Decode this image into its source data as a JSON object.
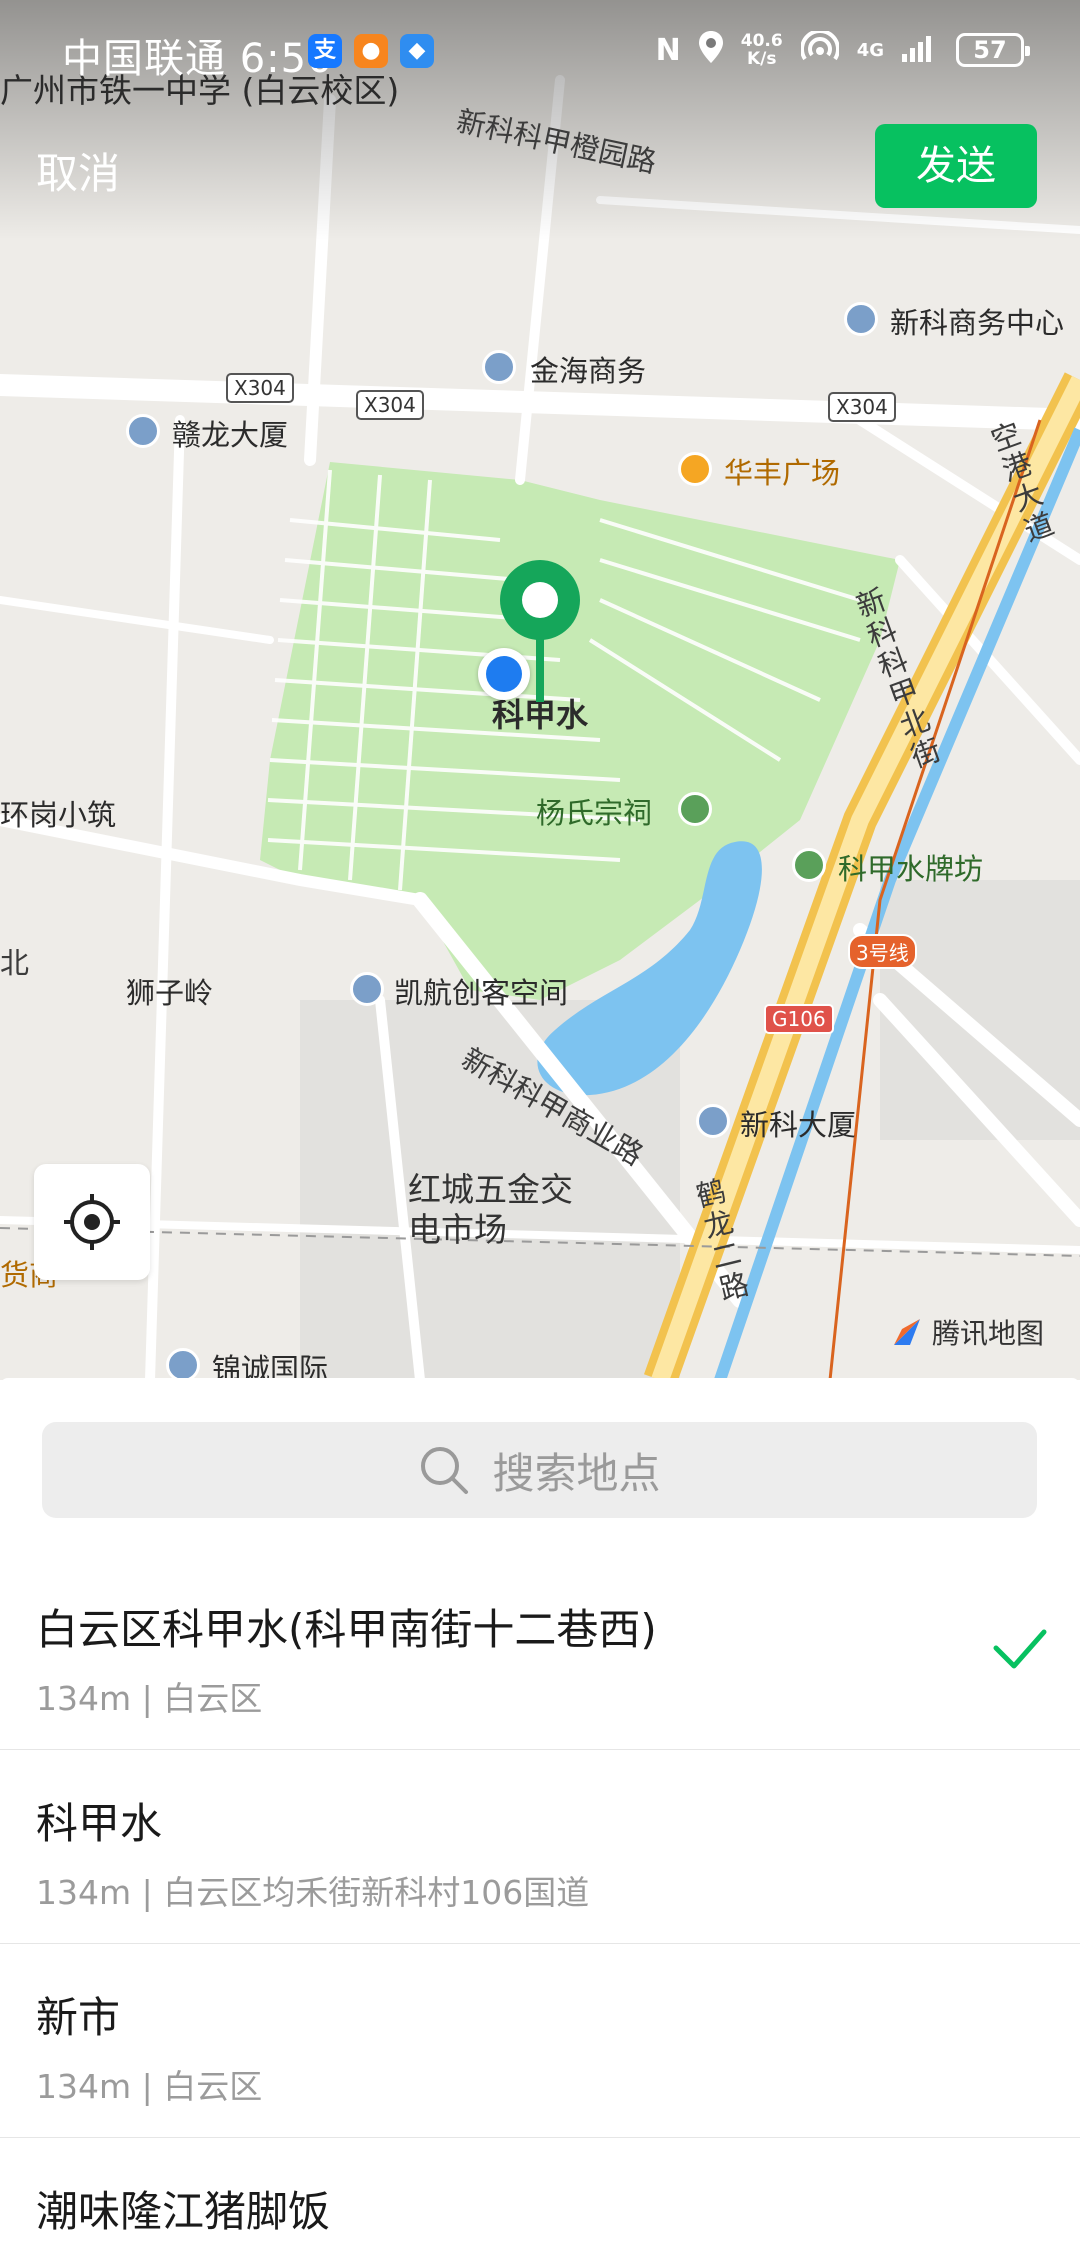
{
  "status_bar": {
    "carrier": "中国联通",
    "time": "6:50",
    "net_speed_value": "40.6",
    "net_speed_unit": "K/s",
    "network": "4G",
    "battery": "57",
    "app_icons": [
      "alipay-icon",
      "app-icon-orange",
      "app-icon-blue"
    ]
  },
  "header": {
    "cancel_label": "取消",
    "send_label": "发送"
  },
  "map": {
    "labels": {
      "school": "广州市铁一中学 (白云校区)",
      "road_top": "新科科甲橙园路",
      "biz_center": "新科商务中心",
      "jinhai": "金海商务",
      "ganlong": "赣龙大厦",
      "huafeng": "华丰广场",
      "konggang": "空港大道",
      "kejiabei": "新科科甲北街",
      "kejiashui": "科甲水",
      "huangang": "环岗小筑",
      "yang_temple": "杨氏宗祠",
      "kejia_arch": "科甲水牌坊",
      "shiziling": "狮子岭",
      "kaihang": "凯航创客空间",
      "kejiashang": "新科科甲商业路",
      "xinke_building": "新科大厦",
      "hongcheng": "红城五金交电市场",
      "helong": "鹤龙二路",
      "jincheng": "锦诚国际",
      "left_edge_1": "北",
      "left_edge_2": "货商"
    },
    "shields": {
      "x304": "X304",
      "g106": "G106",
      "metro": "3号线"
    },
    "logo_text": "腾讯地图"
  },
  "search": {
    "placeholder": "搜索地点"
  },
  "results": [
    {
      "title": "白云区科甲水(科甲南街十二巷西)",
      "subtitle": "134m | 白云区",
      "selected": true
    },
    {
      "title": "科甲水",
      "subtitle": "134m | 白云区均禾街新科村106国道",
      "selected": false
    },
    {
      "title": "新市",
      "subtitle": "134m | 白云区",
      "selected": false
    },
    {
      "title": "潮味隆江猪脚饭",
      "subtitle": "",
      "selected": false
    }
  ],
  "colors": {
    "accent_green": "#07c160",
    "park_green": "#c6eab4",
    "water_blue": "#7dc3f0",
    "pin_green": "#15a65a",
    "location_blue": "#1e7cf0"
  }
}
